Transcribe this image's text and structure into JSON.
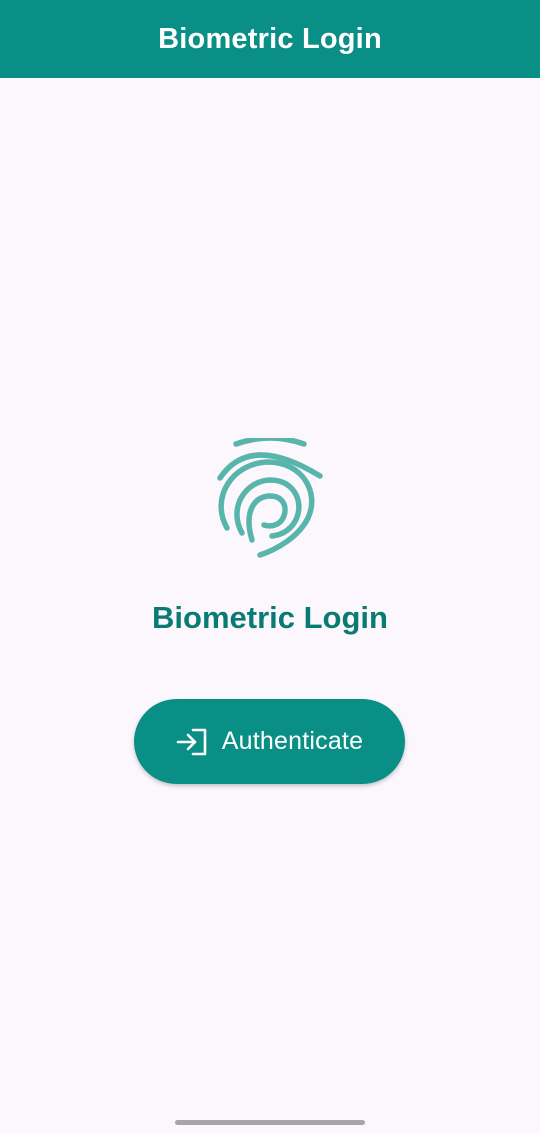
{
  "app_bar": {
    "title": "Biometric Login"
  },
  "main": {
    "icon": "fingerprint-icon",
    "heading": "Biometric Login",
    "button": {
      "icon": "login-icon",
      "label": "Authenticate"
    }
  },
  "colors": {
    "primary": "#0a8f86",
    "heading": "#087b72",
    "icon": "#58b5ac",
    "background": "#fcf6fd"
  }
}
